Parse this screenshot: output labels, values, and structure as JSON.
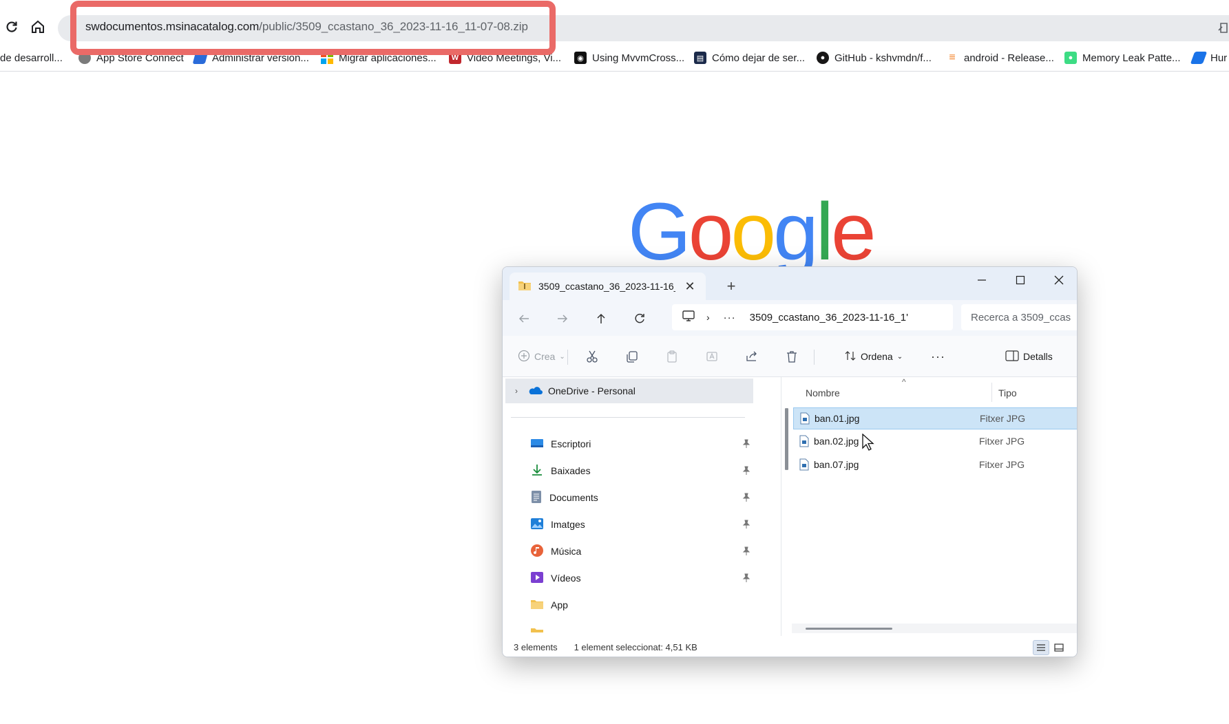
{
  "browser": {
    "url_host": "swdocumentos.msinacatalog.com",
    "url_path": "/public/3509_ccastano_36_2023-11-16_11-07-08.zip",
    "bookmarks": [
      {
        "label": "de desarroll...",
        "icon": "blank",
        "color": "#ffffff"
      },
      {
        "label": "App Store Connect",
        "icon": "apple-icon",
        "color": "#555555"
      },
      {
        "label": "Administrar version...",
        "icon": "pencil-icon",
        "color": "#2a6bd9"
      },
      {
        "label": "Migrar aplicaciones...",
        "icon": "windows-icon",
        "color": "#f25022"
      },
      {
        "label": "Video Meetings, Vi...",
        "icon": "w-icon",
        "color": "#c1272d"
      },
      {
        "label": "Using MvvmCross...",
        "icon": "mvvm-icon",
        "color": "#111111"
      },
      {
        "label": "Cómo dejar de ser...",
        "icon": "book-icon",
        "color": "#1b2a4a"
      },
      {
        "label": "GitHub - kshvmdn/f...",
        "icon": "github-icon",
        "color": "#181717"
      },
      {
        "label": "android - Release...",
        "icon": "stackoverflow-icon",
        "color": "#f48024"
      },
      {
        "label": "Memory Leak Patte...",
        "icon": "android-icon",
        "color": "#3ddc84"
      },
      {
        "label": "Hur",
        "icon": "chart-icon",
        "color": "#1a73e8"
      }
    ]
  },
  "google_logo": {
    "letters": [
      "G",
      "o",
      "o",
      "g",
      "l",
      "e"
    ],
    "colors": [
      "#4285F4",
      "#EA4335",
      "#FBBC05",
      "#4285F4",
      "#34A853",
      "#EA4335"
    ]
  },
  "explorer": {
    "tab_title": "3509_ccastano_36_2023-11-16_",
    "address_path": "3509_ccastano_36_2023-11-16_1'",
    "search_placeholder": "Recerca a 3509_ccas",
    "commands": {
      "new": "Crea",
      "sort": "Ordena",
      "more": "···",
      "details": "Detalls"
    },
    "nav": {
      "root": "OneDrive - Personal",
      "items": [
        {
          "label": "Escriptori",
          "icon": "desktop-icon",
          "pinned": true
        },
        {
          "label": "Baixades",
          "icon": "download-icon",
          "pinned": true
        },
        {
          "label": "Documents",
          "icon": "documents-icon",
          "pinned": true
        },
        {
          "label": "Imatges",
          "icon": "pictures-icon",
          "pinned": true
        },
        {
          "label": "Música",
          "icon": "music-icon",
          "pinned": true
        },
        {
          "label": "Vídeos",
          "icon": "videos-icon",
          "pinned": true
        },
        {
          "label": "App",
          "icon": "folder-icon",
          "pinned": false
        }
      ]
    },
    "columns": {
      "name": "Nombre",
      "type": "Tipo"
    },
    "files": [
      {
        "name": "ban.01.jpg",
        "type": "Fitxer JPG",
        "selected": true
      },
      {
        "name": "ban.02.jpg",
        "type": "Fitxer JPG",
        "selected": false
      },
      {
        "name": "ban.07.jpg",
        "type": "Fitxer JPG",
        "selected": false
      }
    ],
    "status": {
      "count": "3 elements",
      "selection": "1 element seleccionat: 4,51 KB"
    }
  },
  "colors": {
    "highlight_box": "#ea6a67",
    "selection": "#cce4f7",
    "accent": "#0067c0"
  }
}
